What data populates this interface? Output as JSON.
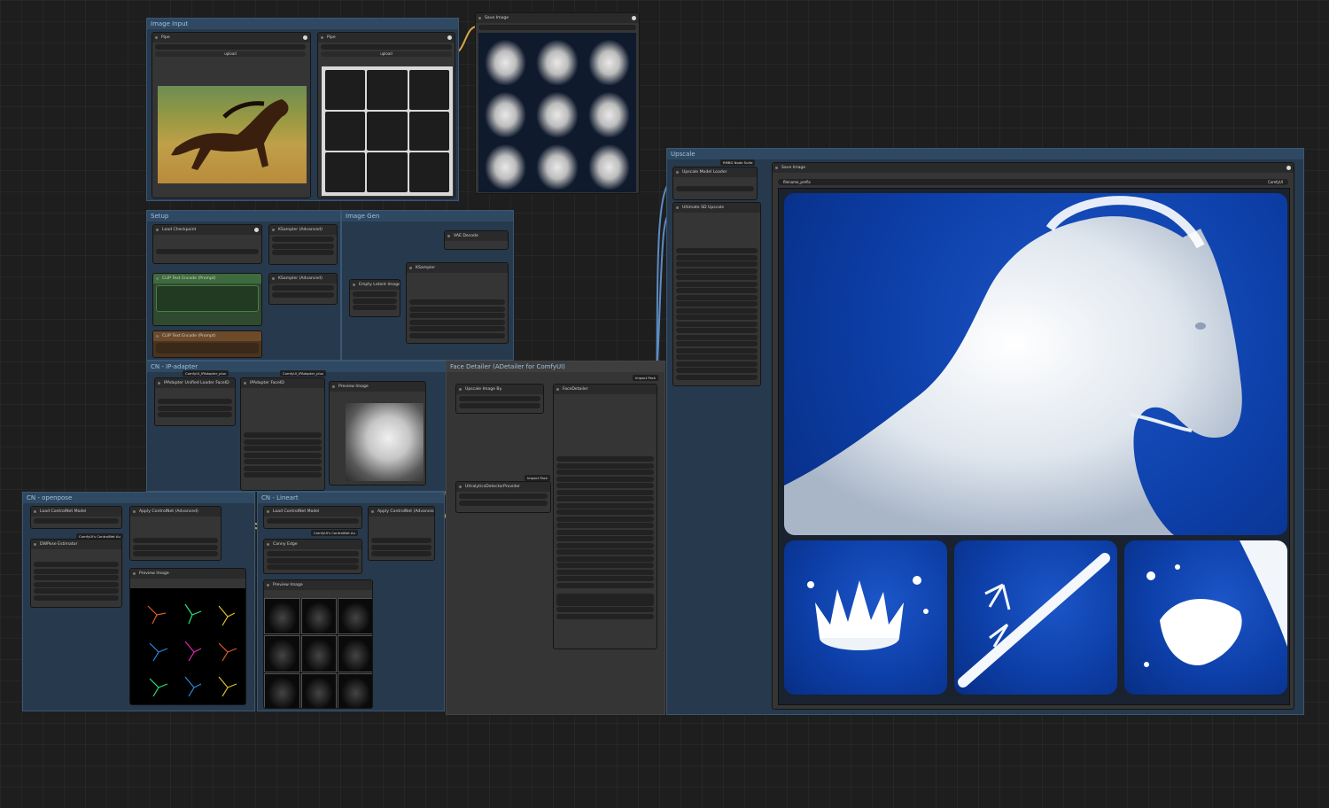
{
  "groups": {
    "image_input": "Image Input",
    "setup": "Setup",
    "image_gen": "Image Gen",
    "cn_ipadapter": "CN - IP-adapter",
    "face_detailer": "Face Detailer (ADetailer for ComfyUI)",
    "cn_openpose": "CN - openpose",
    "cn_lineart": "CN - Lineart",
    "upscale": "Upscale"
  },
  "nodes": {
    "pipe": "Pipe",
    "pipe2": "Pipe",
    "save_image_top": "Save Image",
    "load_checkpoint": "Load Checkpoint",
    "clip_text_encode_pos": "CLIP Text Encode (Prompt)",
    "clip_text_encode_neg": "CLIP Text Encode (Prompt)",
    "ksampler_top": "KSampler (Advanced)",
    "ksampler_mid": "KSampler (Advanced)",
    "vae_decode": "VAE Decode",
    "ksampler": "KSampler",
    "empty_latent": "Empty Latent Image",
    "ipadapter_unified": "IPAdapter Unified Loader FaceID",
    "ipadapter_faceid": "IPAdapter FaceID",
    "preview_image_ip": "Preview Image",
    "upscale_image_by": "Upscale Image By",
    "face_detailer": "FaceDetailer",
    "ultralytics": "UltralyticsDetectorProvider",
    "load_controlnet_op": "Load ControlNet Model",
    "apply_controlnet_op": "Apply ControlNet (Advanced)",
    "dwpose": "DWPose Estimator",
    "preview_image_op": "Preview Image",
    "load_controlnet_la": "Load ControlNet Model",
    "apply_controlnet_la": "Apply ControlNet (Advanced)",
    "canny_edge": "Canny Edge",
    "preview_image_la": "Preview Image",
    "upscale_model_loader": "Upscale Model Loader",
    "ultimate_sd_upscale": "Ultimate SD Upscale",
    "save_image_final": "Save Image"
  },
  "labels": {
    "upload": "upload",
    "upload2": "upload",
    "ipadapter_model1": "ComfyUI_IPAdapter_plus",
    "ipadapter_model2": "ComfyUI_IPAdapter_plus",
    "impact_pack": "Impact Pack",
    "impact_pack2": "Impact Pack",
    "controlnet_op_model": "ComfyUI's ControlNet Au",
    "controlnet_la_model": "ComfyUI's ControlNet Au",
    "rmbg": "RMBG Node Suite",
    "save_filename": "filename_prefix",
    "comfyui_tag": "ComfyUI"
  },
  "colors": {
    "canvas": "#1e1e1e",
    "group": "#27394c",
    "group_title": "#2f4962",
    "node": "#353535",
    "wire_yellow": "#d9a74a",
    "wire_blue": "#5b8cc2",
    "card_blue": "#0d3fa8"
  }
}
